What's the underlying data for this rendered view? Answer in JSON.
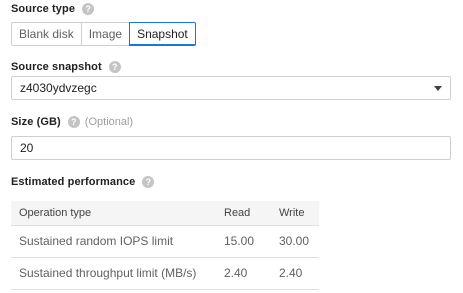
{
  "source_type": {
    "label": "Source type",
    "options": [
      "Blank disk",
      "Image",
      "Snapshot"
    ],
    "selected": "Snapshot"
  },
  "source_snapshot": {
    "label": "Source snapshot",
    "value": "z4030ydvzegc"
  },
  "size": {
    "label": "Size (GB)",
    "optional": "(Optional)",
    "value": "20"
  },
  "performance": {
    "label": "Estimated performance",
    "headers": [
      "Operation type",
      "Read",
      "Write"
    ],
    "rows": [
      {
        "op": "Sustained random IOPS limit",
        "read": "15.00",
        "write": "30.00"
      },
      {
        "op": "Sustained throughput limit (MB/s)",
        "read": "2.40",
        "write": "2.40"
      }
    ]
  },
  "icons": {
    "help": "help-circle-icon",
    "dropdown": "caret-down-icon"
  },
  "colors": {
    "accent": "#1a73e8",
    "help_icon": "#c4c4c4",
    "table_header_bg": "#f5f5f5"
  }
}
